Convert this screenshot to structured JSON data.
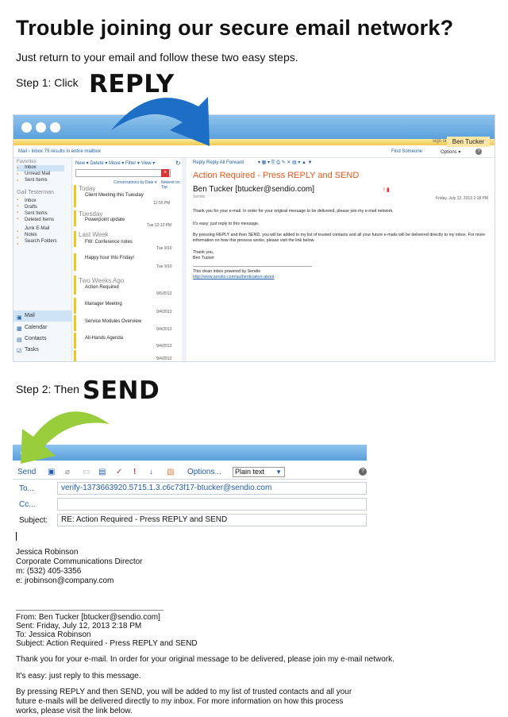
{
  "heading": "Trouble joining our secure email network?",
  "intro": "Just return to your email and follow these two easy steps.",
  "step1": {
    "prefix": "Step 1: Click",
    "action": "REPLY"
  },
  "step2": {
    "prefix": "Step 2: Then",
    "action": "SEND"
  },
  "colors": {
    "accent_blue": "#1f5da8",
    "subject_orange": "#e8581c",
    "arrow_blue": "#1d6fc6",
    "arrow_green": "#9acd3c"
  },
  "inbox": {
    "sign_out": "sign out",
    "user": "Ben Tucker",
    "nav": "Mail › Inbox 79 results in entire mailbox",
    "find_someone": "Find Someone",
    "options": "Options ▾",
    "favorites_label": "Favorites",
    "favorites": [
      "Inbox",
      "Unread Mail",
      "Sent Items"
    ],
    "account_label": "Gail Testerman",
    "folders": [
      "Inbox",
      "Drafts",
      "Sent Items",
      "Deleted Items",
      "Junk E-Mail",
      "Notes",
      "Search Folders"
    ],
    "nav_bottom": [
      "Mail",
      "Calendar",
      "Contacts",
      "Tasks"
    ],
    "mid_toolbar": "New ▾  Delete ▾  Move ▾  Filter ▾  View ▾",
    "conv_by_date": "Conversations by Date ▾",
    "newest_on_top": "Newest on Top",
    "groups": {
      "today": "Today",
      "tuesday": "Tuesday",
      "last_week": "Last Week",
      "two_weeks": "Two Weeks Ago"
    },
    "messages": [
      {
        "subject": "Client Meeting this Tuesday",
        "time": "12:55 PM"
      },
      {
        "subject": "Powerpoint update",
        "time": "Tue 12:13 PM"
      },
      {
        "subject": "FW: Conference notes",
        "time": "Tue 9/10"
      },
      {
        "subject": "Happy hour this Friday!",
        "time": "Tue 9/10"
      },
      {
        "subject": "Action Required",
        "time": "9/5/2013"
      },
      {
        "subject": "Manager Meeting",
        "time": "9/4/2013"
      },
      {
        "subject": "Service Modules Overview",
        "time": "9/4/2013"
      },
      {
        "subject": "All-Hands Agenda",
        "time": "9/4/2013"
      },
      {
        "subject": "",
        "time": "9/4/2013"
      }
    ],
    "reader_toolbar": "Reply   Reply All   Forward",
    "reader_subject": "Action Required - Press REPLY and SEND",
    "reader_from": "Ben Tucker [btucker@sendio.com]",
    "reader_org": "Sendio",
    "reader_date": "Friday, July 12, 2013 2:18 PM",
    "reader_body": [
      "Thank you for your e-mail. In order for your original message to be delivered, please join my e-mail network.",
      "It's easy: just reply to this message.",
      "By pressing REPLY and then SEND, you will be added to my list of trusted contacts and all your future e-mails will be delivered directly to my inbox. For more information on how this process works, please visit the link below.",
      "Thank you,",
      "Ben Tucker",
      "This clean inbox powered by Sendio",
      "http://www.sendio.com/authentication-about"
    ]
  },
  "compose": {
    "send": "Send",
    "options": "Options...",
    "format": "Plain text",
    "to_label": "To...",
    "to_value": "verify-1373663920.5715.1.3.c6c73f17-btucker@sendio.com",
    "cc_label": "Cc...",
    "subject_label": "Subject:",
    "subject_value": "RE: Action Required - Press REPLY and SEND"
  },
  "signature": [
    "Jessica Robinson",
    "Corporate Communications Director",
    "m: (532) 405-3356",
    "e: jrobinson@company.com"
  ],
  "quoted": {
    "from": "From: Ben Tucker [btucker@sendio.com]",
    "sent": "Sent: Friday, July 12, 2013 2:18 PM",
    "to": "To: Jessica Robinson",
    "subject": "Subject: Action Required - Press REPLY and SEND",
    "p1": "Thank you for your e-mail. In order for your original message to be delivered, please join my e-mail network.",
    "p2": "It's easy: just reply to this message.",
    "p3": "By pressing REPLY and then SEND, you will be added to my list of trusted contacts and all your future e-mails will be delivered directly to my inbox. For more information on how this process works, please visit the link below."
  }
}
